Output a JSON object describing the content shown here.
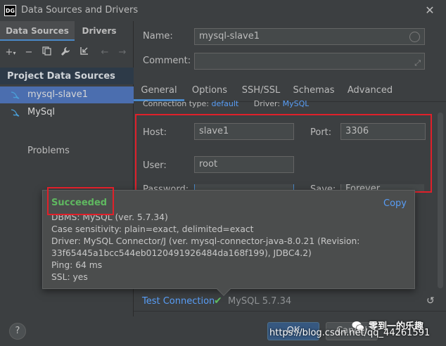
{
  "window": {
    "title": "Data Sources and Drivers",
    "logo": "DG",
    "close": "✕"
  },
  "left": {
    "tabs": [
      "Data Sources",
      "Drivers"
    ],
    "toolbar_icons": [
      "add-icon",
      "remove-icon",
      "duplicate-icon",
      "wrench-icon",
      "import-icon",
      "back-icon",
      "forward-icon"
    ],
    "section_header": "Project Data Sources",
    "items": [
      {
        "label": "mysql-slave1",
        "selected": true
      },
      {
        "label": "MySql",
        "selected": false
      }
    ],
    "problems_label": "Problems"
  },
  "form": {
    "name_label": "Name:",
    "name_value": "mysql-slave1",
    "comment_label": "Comment:",
    "comment_value": "",
    "tabs": [
      "General",
      "Options",
      "SSH/SSL",
      "Schemas",
      "Advanced"
    ],
    "connection_type_label": "Connection type:",
    "connection_type_value": "default",
    "driver_label": "Driver:",
    "driver_value": "MySQL",
    "host_label": "Host:",
    "host_value": "slave1",
    "port_label": "Port:",
    "port_value": "3306",
    "user_label": "User:",
    "user_value": "root",
    "password_label": "Password:",
    "save_label": "Save:",
    "save_value": "Forever"
  },
  "popup": {
    "title": "Succeeded",
    "copy": "Copy",
    "lines": [
      "DBMS: MySQL (ver. 5.7.34)",
      "Case sensitivity: plain=exact, delimited=exact",
      "Driver: MySQL Connector/J (ver. mysql-connector-java-8.0.21 (Revision:",
      "33f65445a1bcc544eb0120491926484da168f199), JDBC4.2)",
      "Ping: 64 ms",
      "SSL: yes"
    ]
  },
  "bottom": {
    "test_connection": "Test Connection",
    "db_version": "MySQL 5.7.34",
    "help": "?",
    "ok": "OK",
    "cancel": "Cancel"
  },
  "watermark": {
    "wechat": "零到一的乐趣",
    "url": "https://blog.csdn.net/qq_44261591"
  },
  "colors": {
    "accent": "#4a88c7",
    "link": "#589df6",
    "success": "#5fb860",
    "highlight": "#e0202a"
  }
}
